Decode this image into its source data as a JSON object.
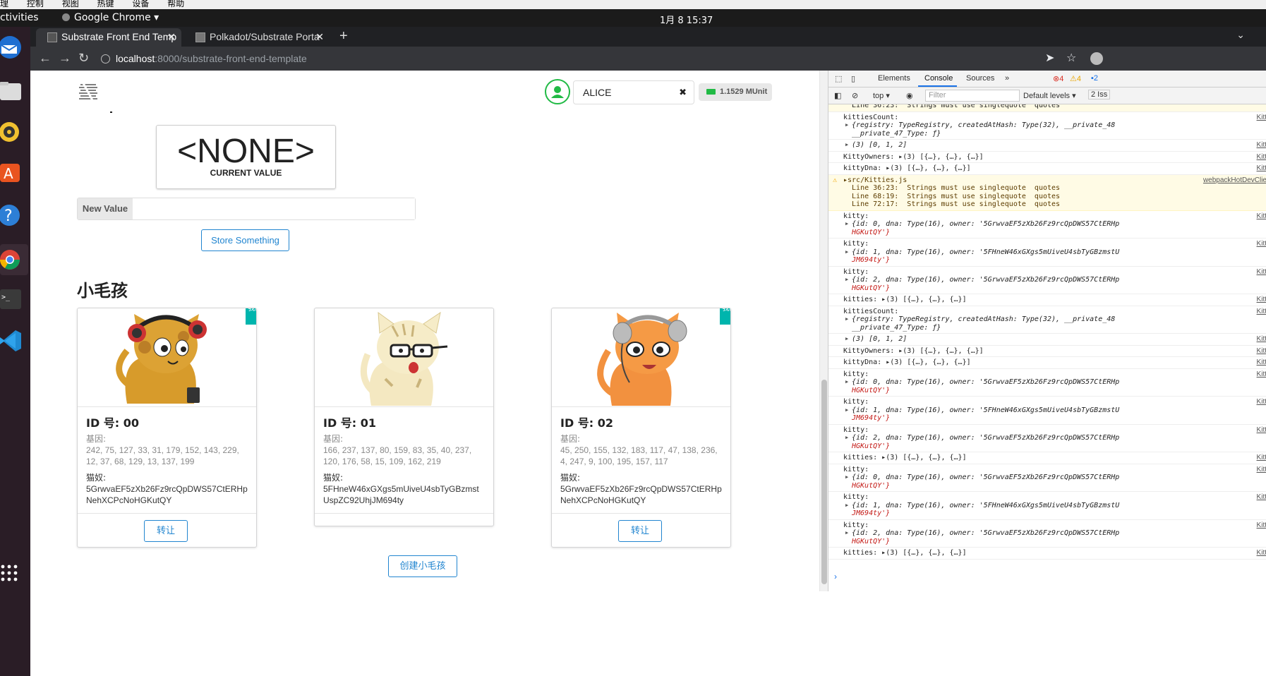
{
  "os": {
    "menubar": [
      "理",
      "控制",
      "视图",
      "热键",
      "设备",
      "帮助"
    ],
    "activities": "ctivities",
    "app_name": "Google Chrome ▾",
    "clock": "1月 8  15:37"
  },
  "browser": {
    "tabs": [
      {
        "title": "Substrate Front End Temp",
        "active": true
      },
      {
        "title": "Polkadot/Substrate Porta",
        "active": false
      }
    ],
    "url_host": "localhost",
    "url_path": ":8000/substrate-front-end-template"
  },
  "header": {
    "account": "ALICE",
    "balance": "1.1529 MUnit"
  },
  "template_module": {
    "current_value": "<NONE>",
    "current_value_label": "CURRENT VALUE",
    "new_value_label": "New Value",
    "new_value": "",
    "store_button": "Store Something"
  },
  "kitties": {
    "heading": "小毛孩",
    "dna_label": "基因:",
    "owner_label": "猫奴:",
    "transfer_label": "转让",
    "mine_label": "我的",
    "create_button": "创建小毛孩",
    "items": [
      {
        "id": "ID 号: 00",
        "dna": "242, 75, 127, 33, 31, 179, 152, 143, 229, 12, 37, 68, 129, 13, 137, 199",
        "owner": "5GrwvaEF5zXb26Fz9rcQpDWS57CtERHpNehXCPcNoHGKutQY",
        "mine": true
      },
      {
        "id": "ID 号: 01",
        "dna": "166, 237, 137, 80, 159, 83, 35, 40, 237, 120, 176, 58, 15, 109, 162, 219",
        "owner": "5FHneW46xGXgs5mUiveU4sbTyGBzmstUspZC92UhjJM694ty",
        "mine": false
      },
      {
        "id": "ID 号: 02",
        "dna": "45, 250, 155, 132, 183, 117, 47, 138, 236, 4, 247, 9, 100, 195, 157, 117",
        "owner": "5GrwvaEF5zXb26Fz9rcQpDWS57CtERHpNehXCPcNoHGKutQY",
        "mine": true
      }
    ]
  },
  "devtools": {
    "tabs": [
      "Elements",
      "Console",
      "Sources",
      "»"
    ],
    "errors": "4",
    "warnings": "4",
    "messages": "2",
    "context": "top ▾",
    "filter_placeholder": "Filter",
    "levels": "Default levels ▾",
    "issues": "2 Iss",
    "logs": [
      {
        "text": "  Line 36:23:  Strings must use singlequote  quotes",
        "src": ""
      },
      {
        "text": "kittiesCount:",
        "obj": "{registry: TypeRegistry, createdAtHash: Type(32), __private_48",
        "obj2": "__private_47_Type: ƒ}",
        "src": "Kitt"
      },
      {
        "text": "",
        "obj": "(3) [0, 1, 2]",
        "src": "Kitt"
      },
      {
        "text": "KittyOwners: ▸(3) [{…}, {…}, {…}]",
        "src": "Kitt"
      },
      {
        "text": "kittyDna: ▸(3) [{…}, {…}, {…}]",
        "src": "Kitt"
      },
      {
        "warn": true,
        "text": "▸src/Kitties.js\n  Line 36:23:  Strings must use singlequote  quotes\n  Line 68:19:  Strings must use singlequote  quotes\n  Line 72:17:  Strings must use singlequote  quotes",
        "src": "webpackHotDevClie"
      },
      {
        "text": "kitty:",
        "obj": "{id: 0, dna: Type(16), owner: '5GrwvaEF5zXb26Fz9rcQpDWS57CtERHp",
        "obj2": "HGKutQY'}",
        "src": "Kitt"
      },
      {
        "text": "kitty:",
        "obj": "{id: 1, dna: Type(16), owner: '5FHneW46xGXgs5mUiveU4sbTyGBzmstU",
        "obj2": "JM694ty'}",
        "src": "Kitt"
      },
      {
        "text": "kitty:",
        "obj": "{id: 2, dna: Type(16), owner: '5GrwvaEF5zXb26Fz9rcQpDWS57CtERHp",
        "obj2": "HGKutQY'}",
        "src": "Kitt"
      },
      {
        "text": "kitties: ▸(3) [{…}, {…}, {…}]",
        "src": "Kitt"
      },
      {
        "text": "kittiesCount:",
        "obj": "{registry: TypeRegistry, createdAtHash: Type(32), __private_48",
        "obj2": "__private_47_Type: ƒ}",
        "src": "Kitt"
      },
      {
        "text": "",
        "obj": "(3) [0, 1, 2]",
        "src": "Kitt"
      },
      {
        "text": "KittyOwners: ▸(3) [{…}, {…}, {…}]",
        "src": "Kitt"
      },
      {
        "text": "kittyDna: ▸(3) [{…}, {…}, {…}]",
        "src": "Kitt"
      },
      {
        "text": "kitty:",
        "obj": "{id: 0, dna: Type(16), owner: '5GrwvaEF5zXb26Fz9rcQpDWS57CtERHp",
        "obj2": "HGKutQY'}",
        "src": "Kitt"
      },
      {
        "text": "kitty:",
        "obj": "{id: 1, dna: Type(16), owner: '5FHneW46xGXgs5mUiveU4sbTyGBzmstU",
        "obj2": "JM694ty'}",
        "src": "Kitt"
      },
      {
        "text": "kitty:",
        "obj": "{id: 2, dna: Type(16), owner: '5GrwvaEF5zXb26Fz9rcQpDWS57CtERHp",
        "obj2": "HGKutQY'}",
        "src": "Kitt"
      },
      {
        "text": "kitties: ▸(3) [{…}, {…}, {…}]",
        "src": "Kitt"
      },
      {
        "text": "kitty:",
        "obj": "{id: 0, dna: Type(16), owner: '5GrwvaEF5zXb26Fz9rcQpDWS57CtERHp",
        "obj2": "HGKutQY'}",
        "src": "Kitt"
      },
      {
        "text": "kitty:",
        "obj": "{id: 1, dna: Type(16), owner: '5FHneW46xGXgs5mUiveU4sbTyGBzmstU",
        "obj2": "JM694ty'}",
        "src": "Kitt"
      },
      {
        "text": "kitty:",
        "obj": "{id: 2, dna: Type(16), owner: '5GrwvaEF5zXb26Fz9rcQpDWS57CtERHp",
        "obj2": "HGKutQY'}",
        "src": "Kitt"
      },
      {
        "text": "kitties: ▸(3) [{…}, {…}, {…}]",
        "src": "Kitt"
      }
    ]
  }
}
